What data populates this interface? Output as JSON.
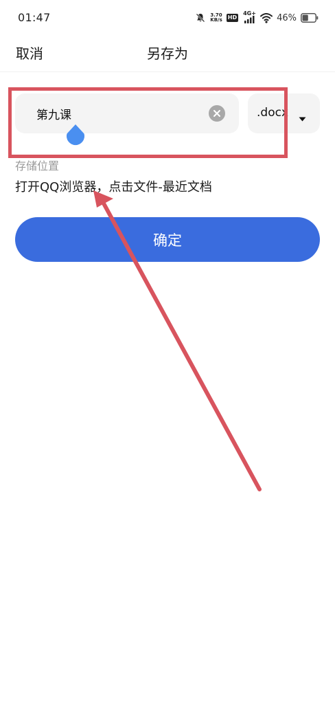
{
  "status_bar": {
    "time": "01:47",
    "net_speed_value": "3.70",
    "net_speed_unit": "KB/s",
    "hd_label": "HD",
    "network_label": "4G+",
    "battery_percent": "46%",
    "battery_level": 0.46
  },
  "header": {
    "cancel_label": "取消",
    "title": "另存为"
  },
  "filename": {
    "value": "第九课"
  },
  "extension": {
    "selected": ".docx"
  },
  "storage": {
    "label": "存储位置",
    "value": "打开QQ浏览器，点击文件-最近文档"
  },
  "confirm": {
    "label": "确定"
  },
  "colors": {
    "accent": "#3a6cde",
    "annotation": "#d8545e",
    "field_bg": "#f4f4f4",
    "cursor_handle": "#4a8ff0"
  }
}
